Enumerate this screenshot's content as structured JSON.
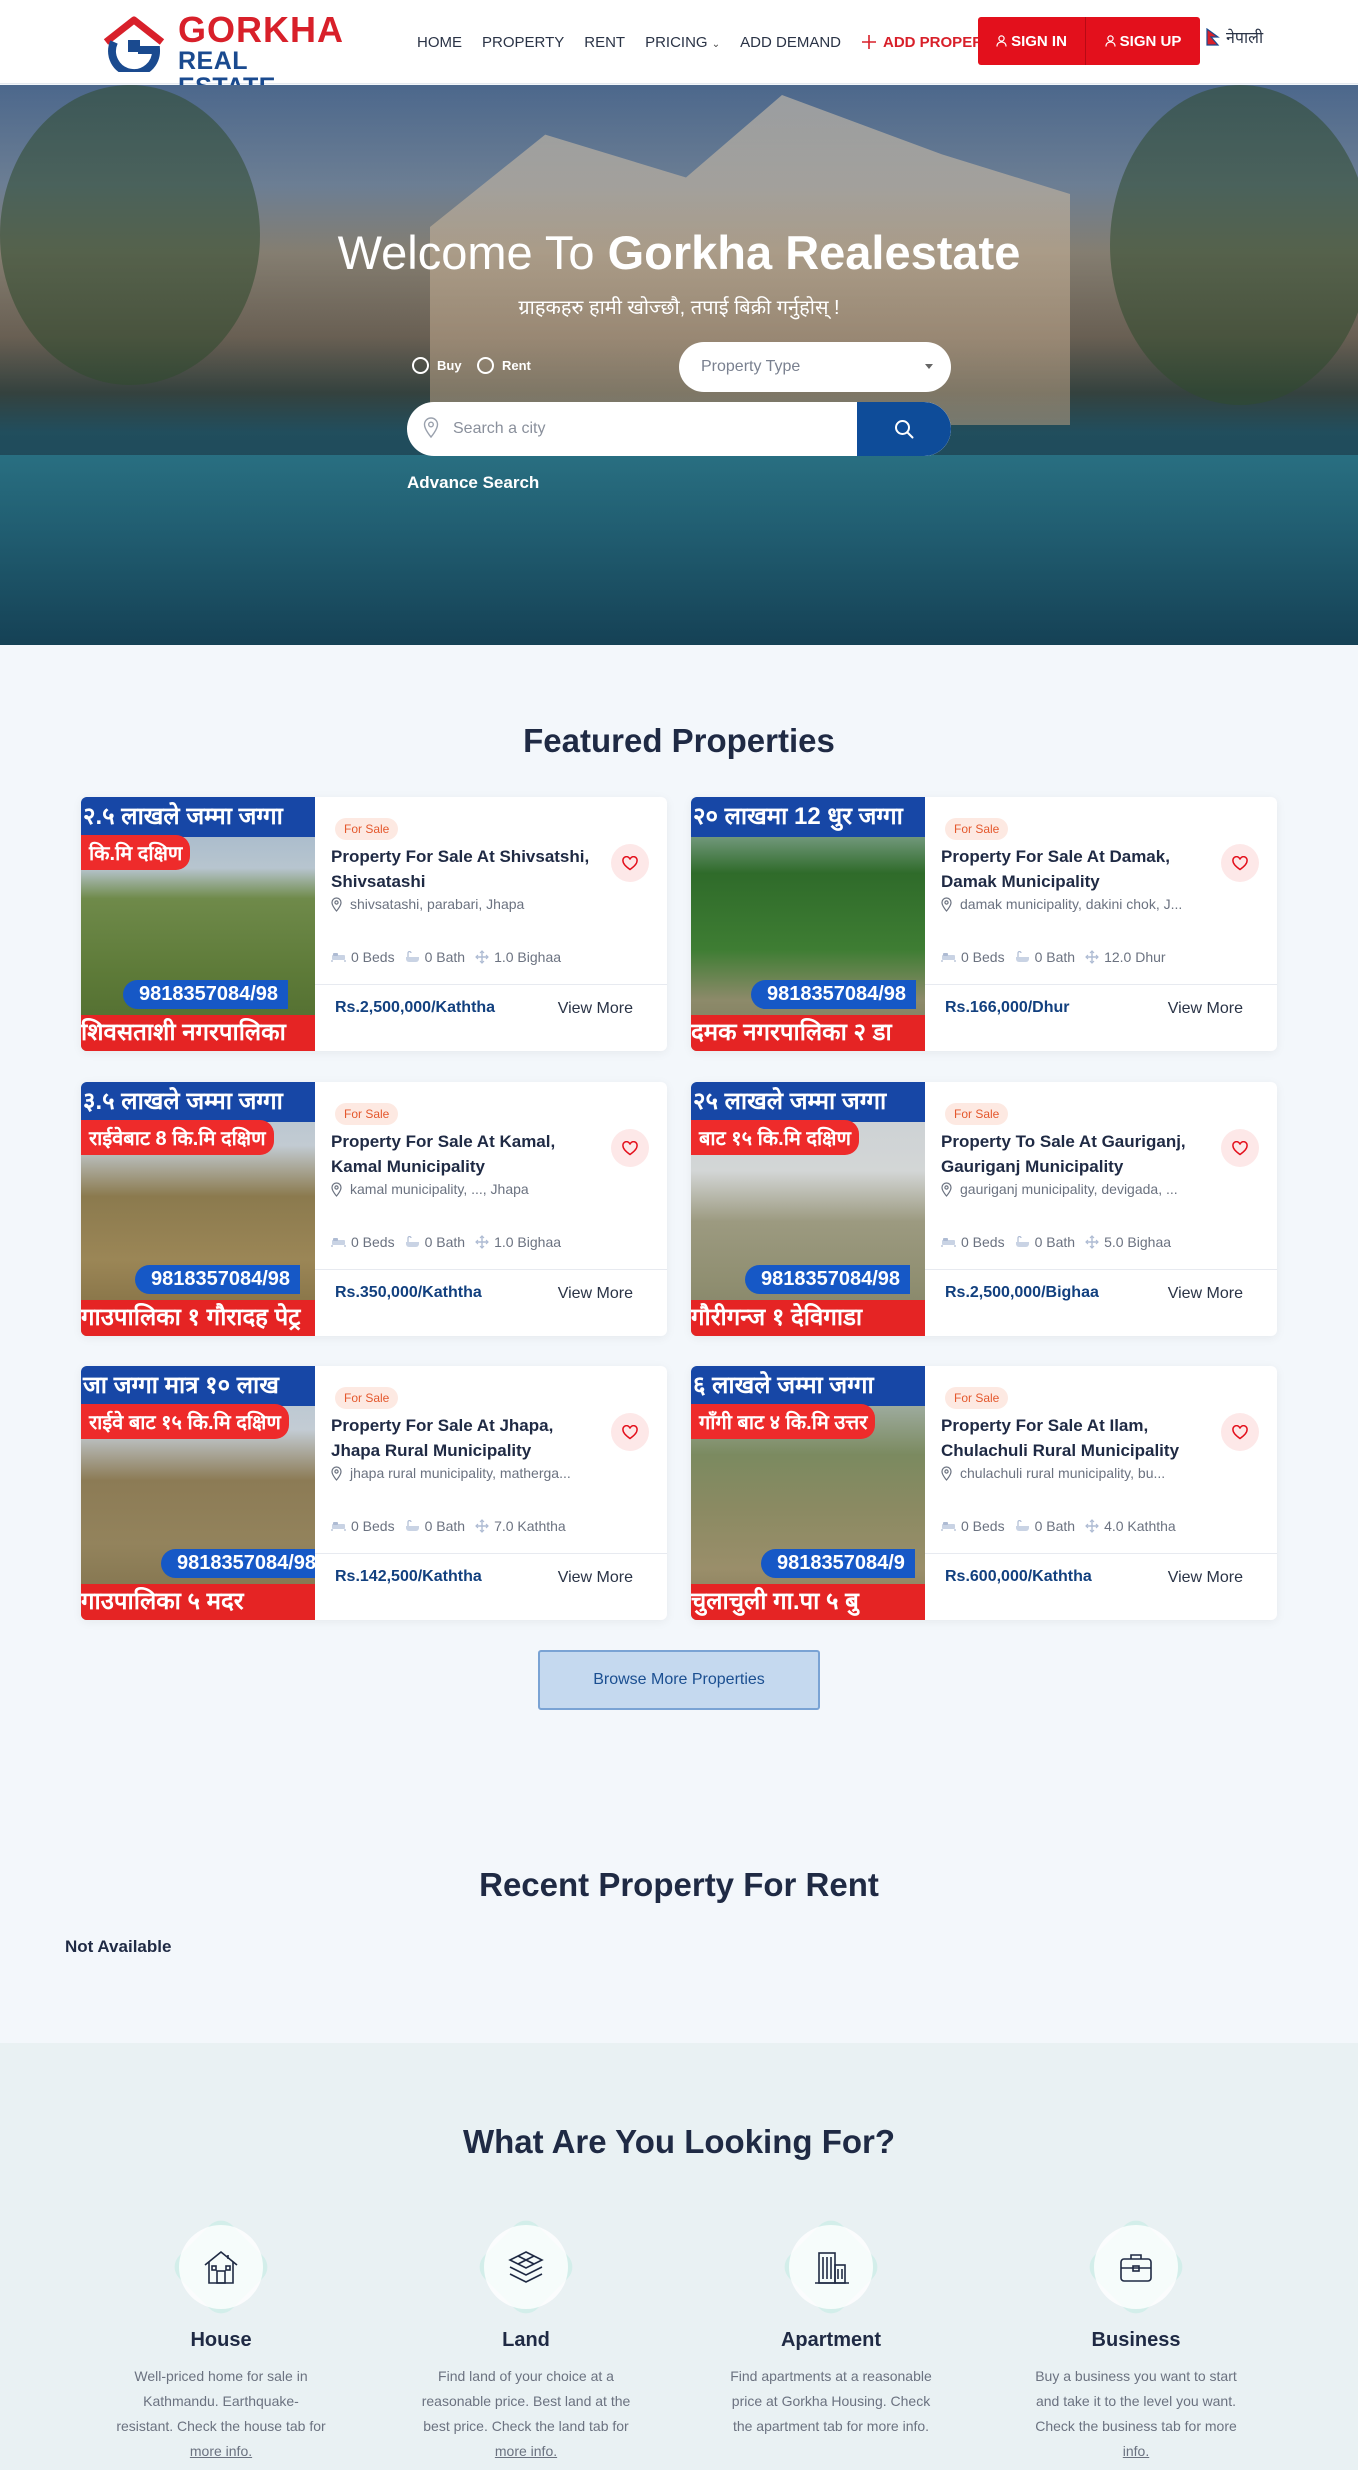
{
  "brand": {
    "line1": "GORKHA",
    "line2": "REAL ESTATE",
    "colors": {
      "red": "#d8202a",
      "blue": "#1a4a8f"
    }
  },
  "nav": {
    "items": [
      "HOME",
      "PROPERTY",
      "RENT",
      "PRICING",
      "ADD DEMAND"
    ],
    "add_property": "ADD PROPERTY",
    "sign_in": "SIGN IN",
    "sign_up": "SIGN UP",
    "language": "नेपाली"
  },
  "hero": {
    "title_light": "Welcome To ",
    "title_bold": "Gorkha Realestate",
    "subtitle": "ग्राहकहरु हामी खोज्छौ, तपाई बिक्री गर्नुहोस् !",
    "radio_buy": "Buy",
    "radio_rent": "Rent",
    "property_type_placeholder": "Property Type",
    "search_placeholder": "Search a city",
    "advance_search": "Advance Search"
  },
  "featured": {
    "title": "Featured Properties",
    "cards": [
      {
        "badge": "For Sale",
        "title": "Property For Sale At Shivsatshi, Shivsatashi",
        "address": "shivsatashi, parabari, Jhapa",
        "beds": "0 Beds",
        "bath": "0 Bath",
        "area": "1.0 Bighaa",
        "price": "Rs.2,500,000/Kaththa",
        "view": "View More",
        "img": {
          "top": "२.५ लाखले जम्मा जग्गा",
          "red": "कि.मि दक्षिण",
          "phone": "9818357084/98",
          "bottom": "शिवसताशी नगरपालिका"
        }
      },
      {
        "badge": "For Sale",
        "title": "Property For Sale At Damak, Damak Municipality",
        "address": "damak municipality, dakini chok, J...",
        "beds": "0 Beds",
        "bath": "0 Bath",
        "area": "12.0 Dhur",
        "price": "Rs.166,000/Dhur",
        "view": "View More",
        "img": {
          "top": "२० लाखमा 12 धुर जग्गा",
          "red": "",
          "phone": "9818357084/98",
          "bottom": "दमक नगरपालिका २ डा"
        }
      },
      {
        "badge": "For Sale",
        "title": "Property For Sale At Kamal, Kamal Municipality",
        "address": "kamal municipality, ..., Jhapa",
        "beds": "0 Beds",
        "bath": "0 Bath",
        "area": "1.0 Bighaa",
        "price": "Rs.350,000/Kaththa",
        "view": "View More",
        "img": {
          "top": "३.५ लाखले जम्मा जग्गा",
          "red": "राईवेबाट 8 कि.मि दक्षिण",
          "phone": "9818357084/98",
          "bottom": "गाउपालिका १ गौरादह पेट्र"
        }
      },
      {
        "badge": "For Sale",
        "title": "Property To Sale At Gauriganj, Gauriganj Municipality",
        "address": "gauriganj municipality, devigada, ...",
        "beds": "0 Beds",
        "bath": "0 Bath",
        "area": "5.0 Bighaa",
        "price": "Rs.2,500,000/Bighaa",
        "view": "View More",
        "img": {
          "top": "२५ लाखले जम्मा जग्गा",
          "red": "बाट १५ कि.मि दक्षिण",
          "phone": "9818357084/98",
          "bottom": "गौरीगन्ज १ देविगाडा"
        }
      },
      {
        "badge": "For Sale",
        "title": "Property For Sale At Jhapa, Jhapa Rural Municipality",
        "address": "jhapa rural municipality, matherga...",
        "beds": "0 Beds",
        "bath": "0 Bath",
        "area": "7.0 Kaththa",
        "price": "Rs.142,500/Kaththa",
        "view": "View More",
        "img": {
          "top": "जा जग्गा मात्र १० लाख",
          "red": "राईवे बाट १५ कि.मि दक्षिण",
          "phone": "9818357084/98",
          "bottom": "गाउपालिका ५ मदर"
        }
      },
      {
        "badge": "For Sale",
        "title": "Property For Sale At Ilam, Chulachuli Rural Municipality",
        "address": "chulachuli rural municipality, bu...",
        "beds": "0 Beds",
        "bath": "0 Bath",
        "area": "4.0 Kaththa",
        "price": "Rs.600,000/Kaththa",
        "view": "View More",
        "img": {
          "top": "६ लाखले जम्मा जग्गा",
          "red": "गाँगी बाट ४ कि.मि उत्तर",
          "phone": "9818357084/9",
          "bottom": "चुलाचुली गा.पा ५ बु"
        }
      }
    ],
    "browse_label": "Browse More Properties"
  },
  "rent": {
    "title": "Recent Property For Rent",
    "empty": "Not Available"
  },
  "categories": {
    "title": "What Are You Looking For?",
    "items": [
      {
        "name": "House",
        "icon": "house-icon",
        "desc_lines": [
          "Well-priced home for sale in",
          "Kathmandu. Earthquake-",
          "resistant. Check the house tab for"
        ],
        "link": "more info."
      },
      {
        "name": "Land",
        "icon": "land-layers-icon",
        "desc_lines": [
          "Find land of your choice at a",
          "reasonable price. Best land at the",
          "best price. Check the land tab for"
        ],
        "link": "more info."
      },
      {
        "name": "Apartment",
        "icon": "apartment-building-icon",
        "desc_lines": [
          "Find apartments at a reasonable",
          "price at Gorkha Housing. Check",
          "the apartment tab for more info."
        ],
        "link": ""
      },
      {
        "name": "Business",
        "icon": "briefcase-icon",
        "desc_lines": [
          "Buy a business you want to start",
          "and take it to the level you want.",
          "Check the business tab for more"
        ],
        "link": "info."
      }
    ]
  }
}
